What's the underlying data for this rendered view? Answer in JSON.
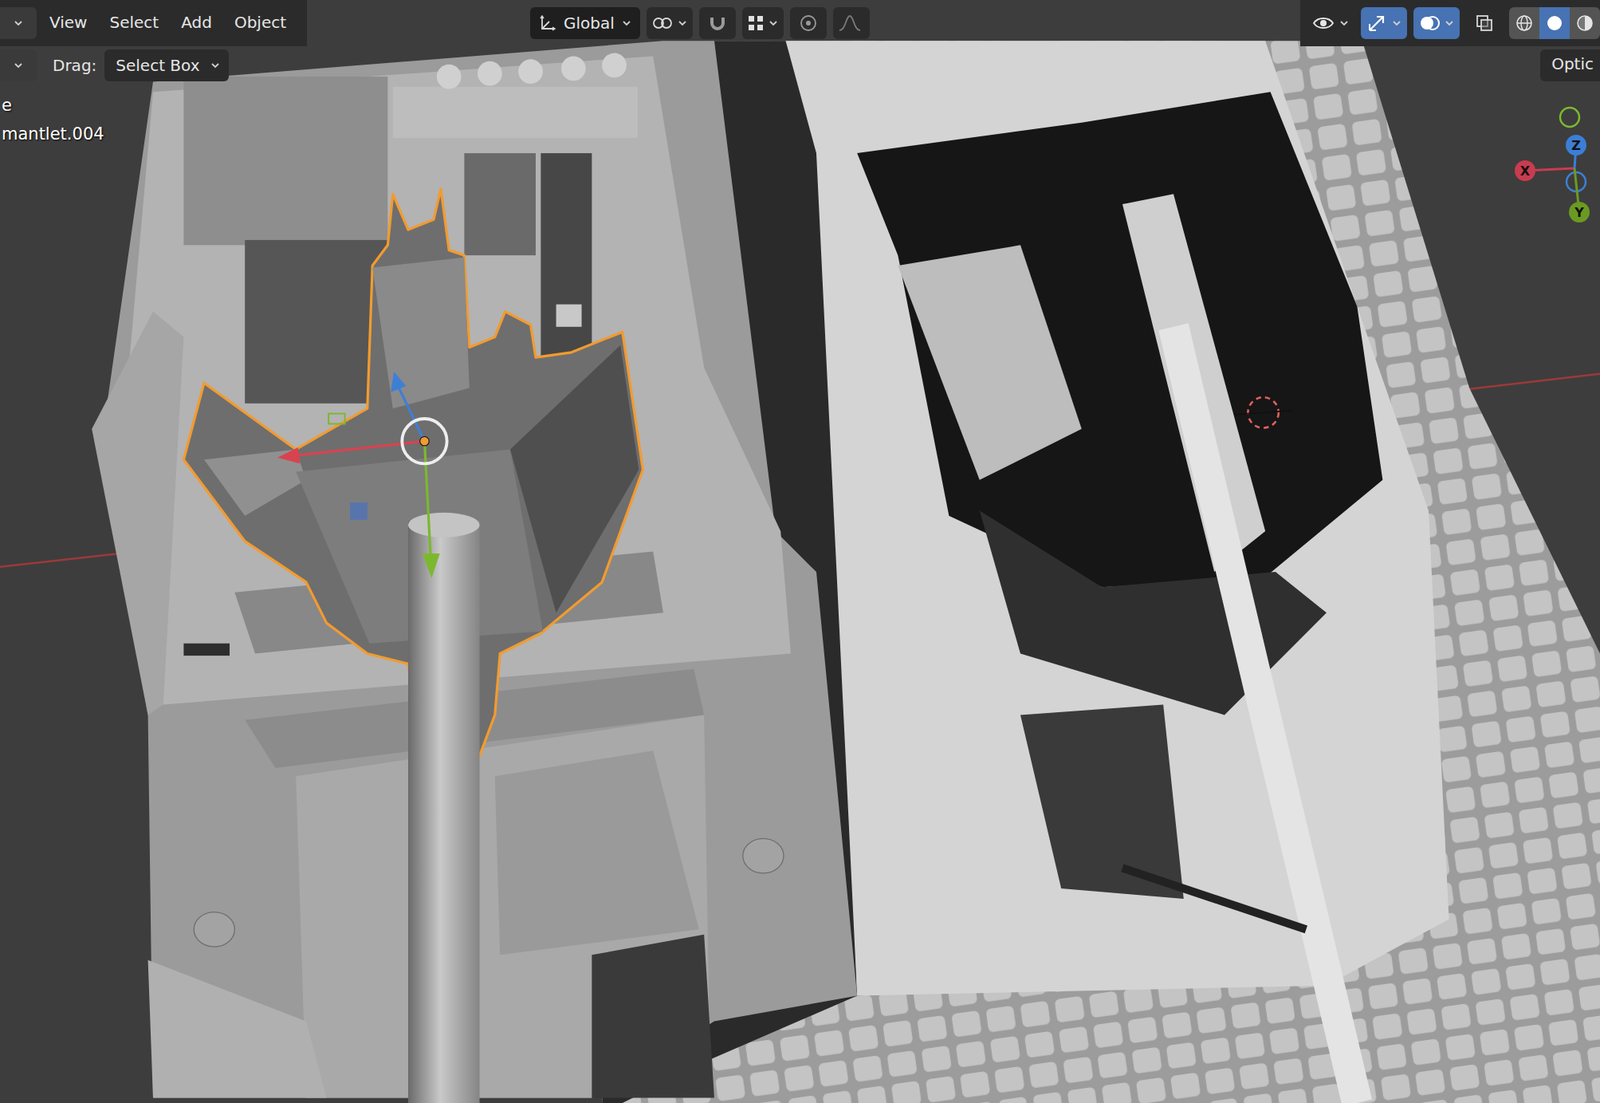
{
  "header": {
    "menus": [
      {
        "label": "View"
      },
      {
        "label": "Select"
      },
      {
        "label": "Add"
      },
      {
        "label": "Object"
      }
    ],
    "orientation": {
      "label": "Global"
    },
    "snapping": {
      "on": false
    },
    "proportional_editing": {
      "on": false
    },
    "show_gizmo": {
      "on": true
    },
    "show_overlays": {
      "on": true
    },
    "xray": {
      "on": false
    },
    "shading": [
      {
        "kind": "wireframe",
        "selected": false
      },
      {
        "kind": "solid",
        "selected": true
      },
      {
        "kind": "material",
        "selected": false
      }
    ]
  },
  "tool_settings": {
    "drag_label": "Drag:",
    "drag_value": "Select Box"
  },
  "options_button": {
    "label": "Optic"
  },
  "viewport_info": {
    "lines": [
      "e",
      "mantlet.004"
    ]
  },
  "active_object": {
    "selected": true
  },
  "gizmo_axes": [
    {
      "label": "X",
      "color": "#c83c50"
    },
    {
      "label": "Y",
      "color": "#6b9a22"
    },
    {
      "label": "Z",
      "color": "#3c7ed6"
    }
  ]
}
